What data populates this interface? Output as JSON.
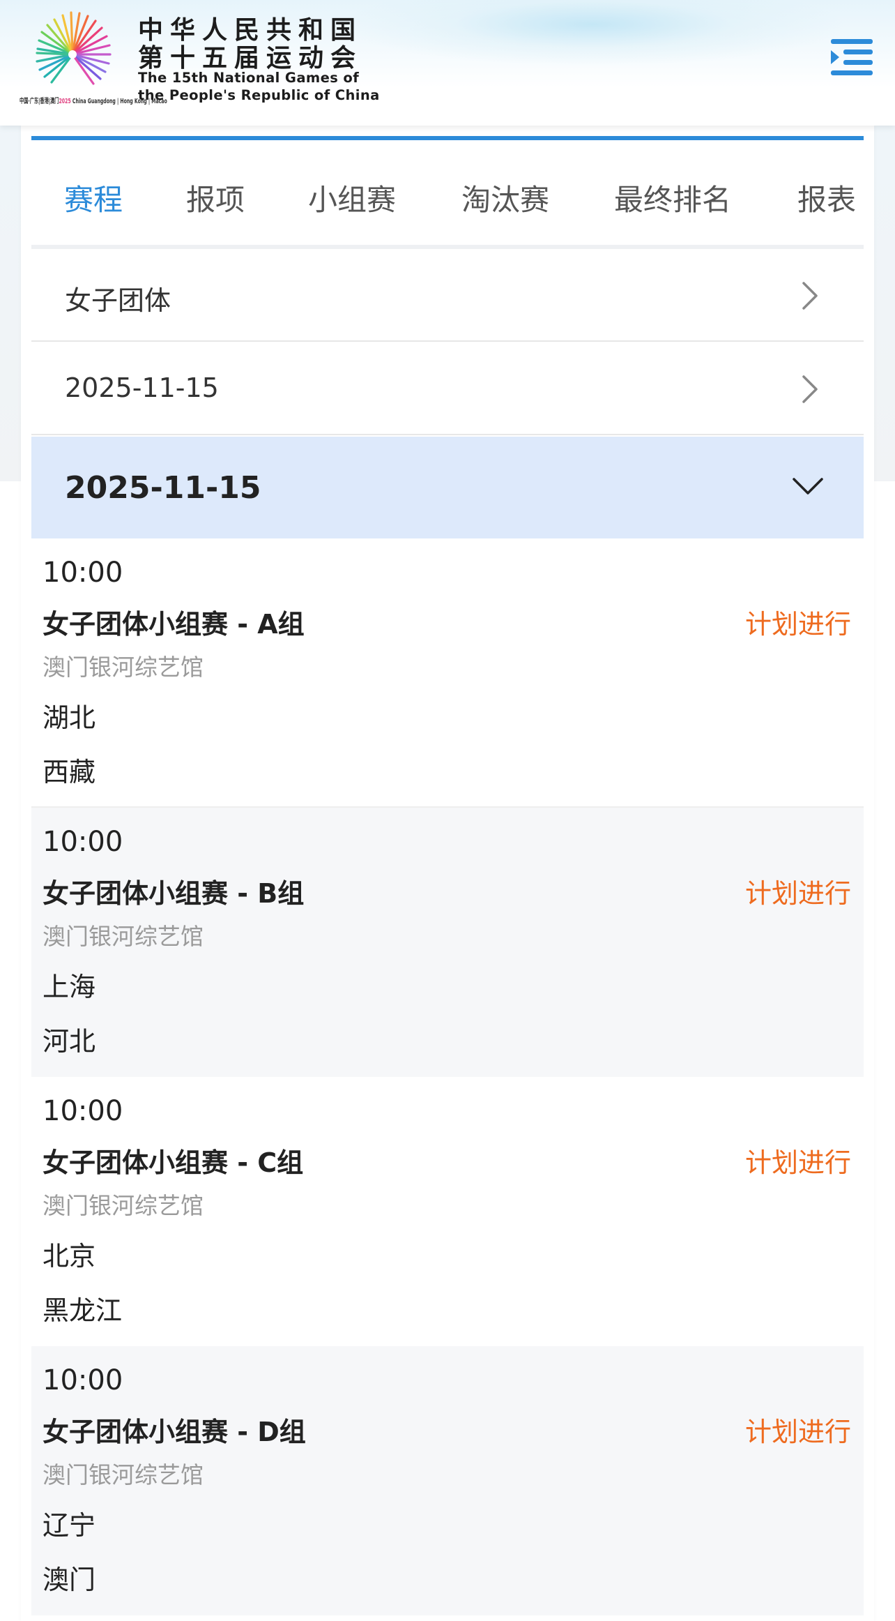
{
  "header": {
    "title_cn_line1": "中华人民共和国",
    "title_cn_line2": "第十五届运动会",
    "title_en_line1": "The 15th National Games of",
    "title_en_line2": "the People's Republic of China",
    "logo_caption": "中国·广东|香港|澳门",
    "logo_year": "2025",
    "logo_caption_en": "China Guangdong | Hong Kong | Macao",
    "menu_icon": "menu-indent-icon"
  },
  "colors": {
    "accent": "#2c8bd9",
    "status": "#ee6b1f",
    "date_header_bg": "#dde9fb",
    "muted": "#9a9a9a"
  },
  "tabs": [
    {
      "label": "赛程",
      "active": true
    },
    {
      "label": "报项",
      "active": false
    },
    {
      "label": "小组赛",
      "active": false
    },
    {
      "label": "淘汰赛",
      "active": false
    },
    {
      "label": "最终排名",
      "active": false
    },
    {
      "label": "报表",
      "active": false
    }
  ],
  "selectors": {
    "event": "女子团体",
    "date": "2025-11-15"
  },
  "schedule": {
    "date_header": "2025-11-15",
    "matches": [
      {
        "time": "10:00",
        "name": "女子团体小组赛 - A组",
        "status": "计划进行",
        "venue": "澳门银河综艺馆",
        "team1": "湖北",
        "team2": "西藏"
      },
      {
        "time": "10:00",
        "name": "女子团体小组赛 - B组",
        "status": "计划进行",
        "venue": "澳门银河综艺馆",
        "team1": "上海",
        "team2": "河北"
      },
      {
        "time": "10:00",
        "name": "女子团体小组赛 - C组",
        "status": "计划进行",
        "venue": "澳门银河综艺馆",
        "team1": "北京",
        "team2": "黑龙江"
      },
      {
        "time": "10:00",
        "name": "女子团体小组赛 - D组",
        "status": "计划进行",
        "venue": "澳门银河综艺馆",
        "team1": "辽宁",
        "team2": "澳门"
      }
    ]
  }
}
